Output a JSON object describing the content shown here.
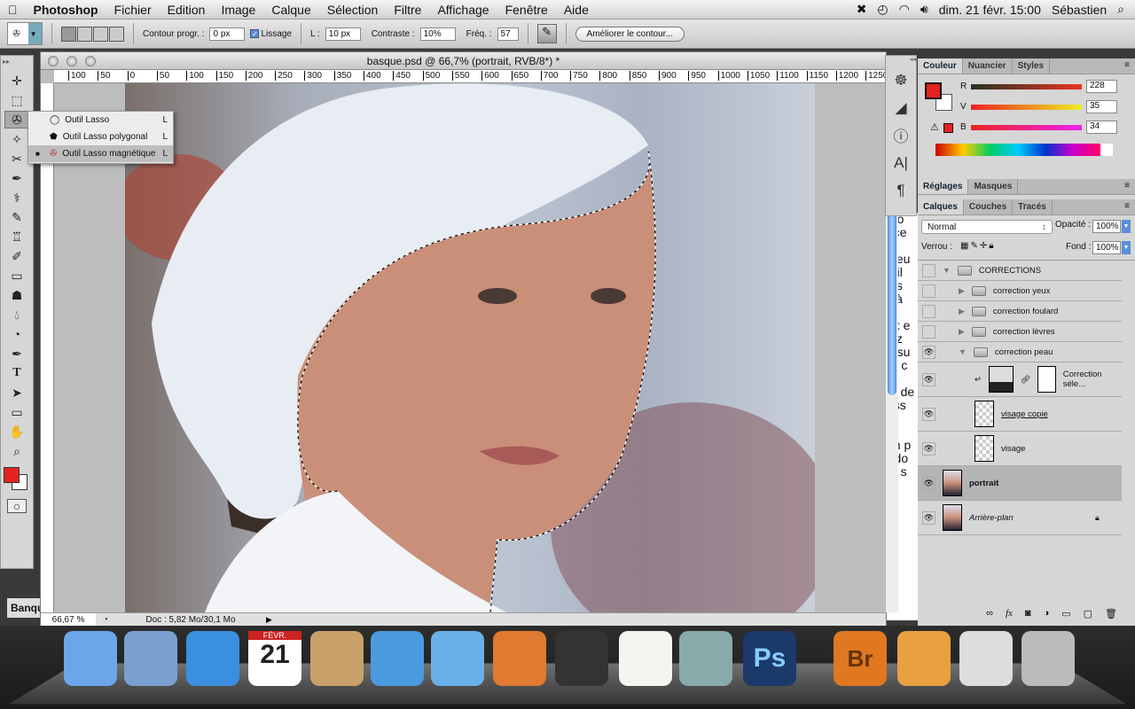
{
  "menubar": {
    "app": "Photoshop",
    "items": [
      "Fichier",
      "Edition",
      "Image",
      "Calque",
      "Sélection",
      "Filtre",
      "Affichage",
      "Fenêtre",
      "Aide"
    ],
    "clock": "dim. 21 févr. 15:00",
    "user": "Sébastien"
  },
  "options": {
    "feather_label": "Contour progr. :",
    "feather_value": "0 px",
    "smooth_label": "Lissage",
    "smooth_checked": true,
    "width_label": "L :",
    "width_value": "10 px",
    "contrast_label": "Contraste :",
    "contrast_value": "10%",
    "freq_label": "Fréq. :",
    "freq_value": "57",
    "refine_button": "Améliorer le contour..."
  },
  "flyout": [
    {
      "label": "Outil Lasso",
      "key": "L"
    },
    {
      "label": "Outil Lasso polygonal",
      "key": "L"
    },
    {
      "label": "Outil Lasso magnétique",
      "key": "L",
      "selected": true
    }
  ],
  "document": {
    "title": "basque.psd @ 66,7% (portrait, RVB/8*) *",
    "ruler_ticks": [
      "100",
      "50",
      "0",
      "50",
      "100",
      "150",
      "200",
      "250",
      "300",
      "350",
      "400",
      "450",
      "500",
      "550",
      "600",
      "650",
      "700",
      "750",
      "800",
      "850",
      "900",
      "950",
      "1000",
      "1050",
      "1100",
      "1150",
      "1200",
      "1250"
    ],
    "zoom": "66,67 %",
    "doc_info": "Doc : 5,82 Mo/30,1 Mo"
  },
  "background_page": {
    "fragments": [
      "oto",
      "éce",
      "",
      "cteu",
      "util",
      "uis",
      "il à",
      "",
      "ux e",
      "lez",
      "à su",
      "ur c",
      "",
      "nt de",
      "uss",
      "",
      "",
      "en p",
      "r do",
      "nt s"
    ],
    "left_label": "Banqu"
  },
  "color_panel": {
    "tabs": [
      "Couleur",
      "Nuancier",
      "Styles"
    ],
    "channels": [
      {
        "label": "R",
        "value": "228"
      },
      {
        "label": "V",
        "value": "35"
      },
      {
        "label": "B",
        "value": "34"
      }
    ],
    "foreground": "#e42322",
    "background": "#ffffff"
  },
  "adjust_panel": {
    "tabs": [
      "Réglages",
      "Masques"
    ]
  },
  "layers_panel": {
    "tabs": [
      "Calques",
      "Couches",
      "Tracés"
    ],
    "blend_mode": "Normal",
    "opacity_label": "Opacité :",
    "opacity": "100%",
    "lock_label": "Verrou :",
    "fill_label": "Fond :",
    "fill": "100%",
    "layers": [
      {
        "name": "CORRECTIONS",
        "type": "group",
        "expanded": true,
        "visible": false,
        "indent": 0
      },
      {
        "name": "correction yeux",
        "type": "group",
        "expanded": false,
        "visible": false,
        "indent": 1
      },
      {
        "name": "correction foulard",
        "type": "group",
        "expanded": false,
        "visible": false,
        "indent": 1
      },
      {
        "name": "correction lèvres",
        "type": "group",
        "expanded": false,
        "visible": false,
        "indent": 1
      },
      {
        "name": "correction peau",
        "type": "group",
        "expanded": true,
        "visible": true,
        "indent": 1
      },
      {
        "name": "Correction séle...",
        "type": "adjustment",
        "visible": true,
        "indent": 2
      },
      {
        "name": "visage copie",
        "type": "pixel",
        "visible": true,
        "indent": 2
      },
      {
        "name": "visage",
        "type": "pixel",
        "visible": true,
        "indent": 2
      },
      {
        "name": "portrait",
        "type": "pixel",
        "visible": true,
        "selected": true,
        "indent": 0
      },
      {
        "name": "Arrière-plan",
        "type": "background",
        "visible": true,
        "locked": true,
        "indent": 0
      }
    ]
  },
  "dock": [
    "Finder",
    "Aperçu",
    "Safari",
    "iCal",
    "Carnet d'adresses",
    "iChat",
    "iTunes",
    "iPhoto",
    "Photo Booth",
    "TextEdit",
    "Aperçu photos",
    "Photoshop",
    "Bridge",
    "Applications",
    "Documents",
    "Corbeille"
  ],
  "dock_date": {
    "month": "FÉVR.",
    "day": "21"
  }
}
